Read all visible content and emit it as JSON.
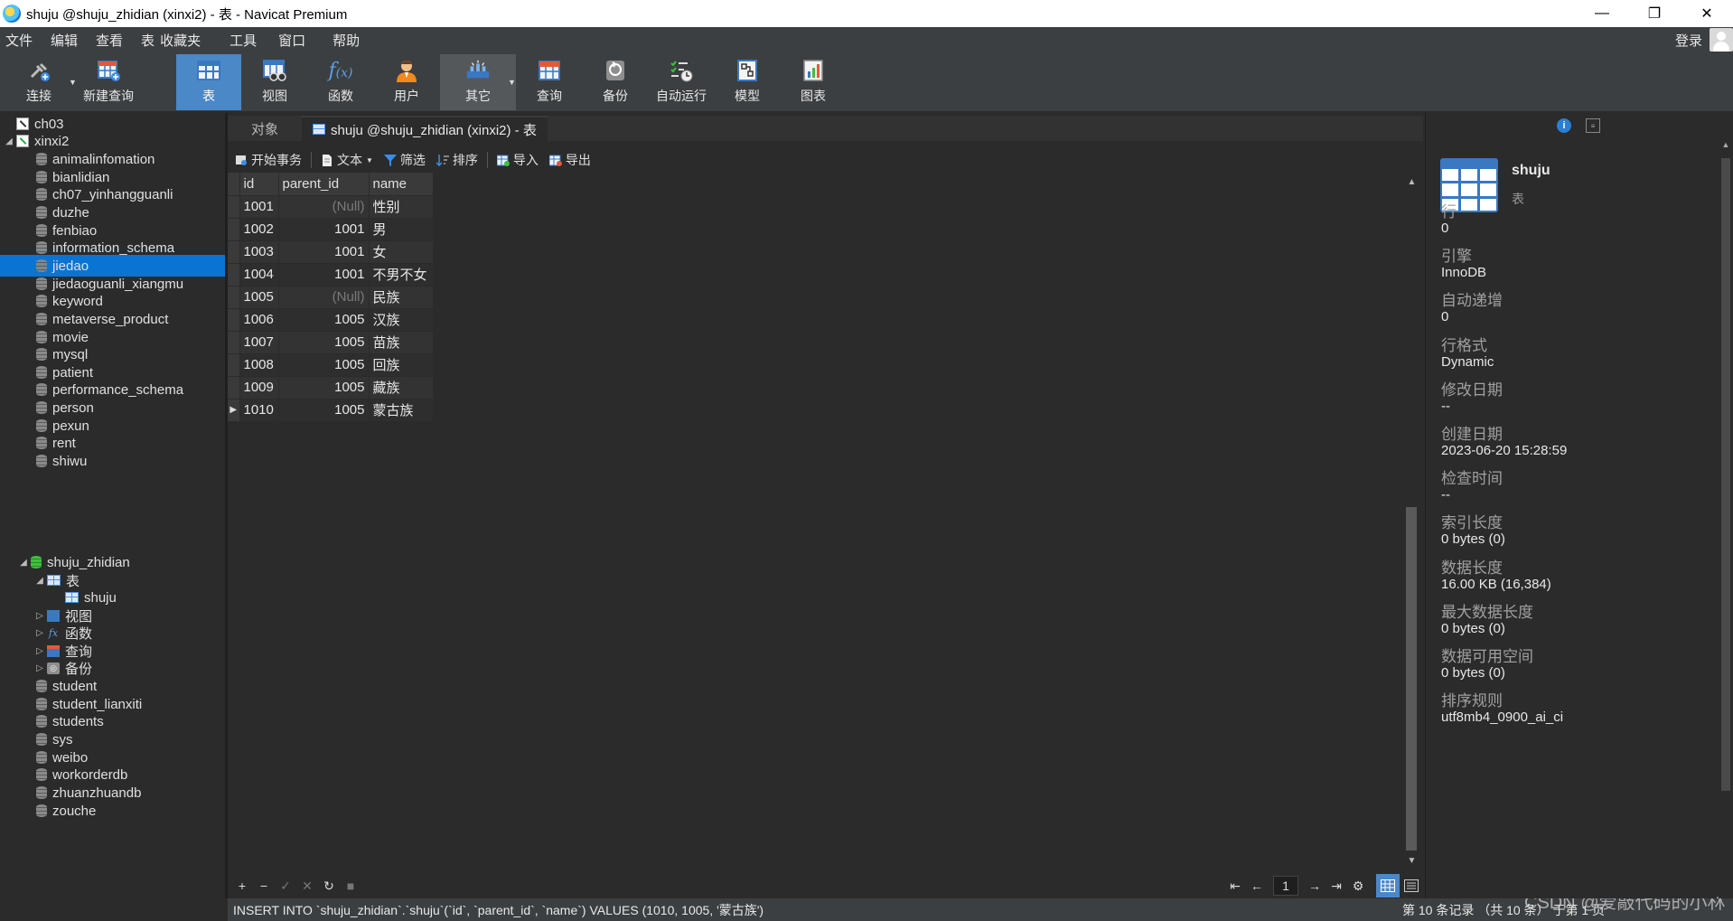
{
  "window": {
    "title": "shuju @shuju_zhidian (xinxi2) - 表 - Navicat Premium",
    "minimize": "—",
    "restore": "❐",
    "close": "✕"
  },
  "menu": [
    "文件",
    "编辑",
    "查看",
    "表",
    "收藏夹",
    "工具",
    "窗口",
    "帮助"
  ],
  "login": "登录",
  "toolbar": {
    "connect": "连接",
    "new_query": "新建查询",
    "table": "表",
    "view": "视图",
    "function": "函数",
    "user": "用户",
    "other": "其它",
    "query": "查询",
    "backup": "备份",
    "auto_run": "自动运行",
    "model": "模型",
    "chart": "图表"
  },
  "tree": {
    "connections": [
      "ch03",
      "xinxi2"
    ],
    "databases_before": [
      "animalinfomation",
      "bianlidian",
      "ch07_yinhangguanli",
      "duzhe",
      "fenbiao",
      "information_schema",
      "jiedao",
      "jiedaoguanli_xiangmu",
      "keyword",
      "metaverse_product",
      "movie",
      "mysql",
      "patient",
      "performance_schema",
      "person",
      "pexun",
      "rent",
      "shiwu"
    ],
    "selected": "jiedao",
    "open_db": "shuju_zhidian",
    "tables_node": "表",
    "table_item": "shuju",
    "views_node": "视图",
    "functions_node": "函数",
    "queries_node": "查询",
    "backups_node": "备份",
    "databases_after": [
      "student",
      "student_lianxiti",
      "students",
      "sys",
      "weibo",
      "workorderdb",
      "zhuanzhuandb",
      "zouche"
    ]
  },
  "tabs": {
    "objects": "对象",
    "active": "shuju @shuju_zhidian (xinxi2) - 表"
  },
  "subtoolbar": {
    "begin_tx": "开始事务",
    "text": "文本",
    "filter": "筛选",
    "sort": "排序",
    "import": "导入",
    "export": "导出"
  },
  "grid": {
    "columns": [
      "id",
      "parent_id",
      "name"
    ],
    "rows": [
      [
        "1001",
        "(Null)",
        "性别"
      ],
      [
        "1002",
        "1001",
        "男"
      ],
      [
        "1003",
        "1001",
        "女"
      ],
      [
        "1004",
        "1001",
        "不男不女"
      ],
      [
        "1005",
        "(Null)",
        "民族"
      ],
      [
        "1006",
        "1005",
        "汉族"
      ],
      [
        "1007",
        "1005",
        "苗族"
      ],
      [
        "1008",
        "1005",
        "回族"
      ],
      [
        "1009",
        "1005",
        "藏族"
      ],
      [
        "1010",
        "1005",
        "蒙古族"
      ]
    ],
    "current_row": 9
  },
  "navbar": {
    "page": "1"
  },
  "status": {
    "sql": "INSERT INTO `shuju_zhidian`.`shuju`(`id`, `parent_id`, `name`) VALUES (1010, 1005, '蒙古族')",
    "records": "第 10 条记录 （共 10 条） 于第 1 页",
    "watermark": "CSDN @爱敲代码的小林"
  },
  "info": {
    "name": "shuju",
    "type": "表",
    "props": [
      {
        "label": "行",
        "value": "0"
      },
      {
        "label": "引擎",
        "value": "InnoDB"
      },
      {
        "label": "自动递增",
        "value": "0"
      },
      {
        "label": "行格式",
        "value": "Dynamic"
      },
      {
        "label": "修改日期",
        "value": "--"
      },
      {
        "label": "创建日期",
        "value": "2023-06-20 15:28:59"
      },
      {
        "label": "检查时间",
        "value": "--"
      },
      {
        "label": "索引长度",
        "value": "0 bytes (0)"
      },
      {
        "label": "数据长度",
        "value": "16.00 KB (16,384)"
      },
      {
        "label": "最大数据长度",
        "value": "0 bytes (0)"
      },
      {
        "label": "数据可用空间",
        "value": "0 bytes (0)"
      },
      {
        "label": "排序规则",
        "value": "utf8mb4_0900_ai_ci"
      }
    ]
  }
}
